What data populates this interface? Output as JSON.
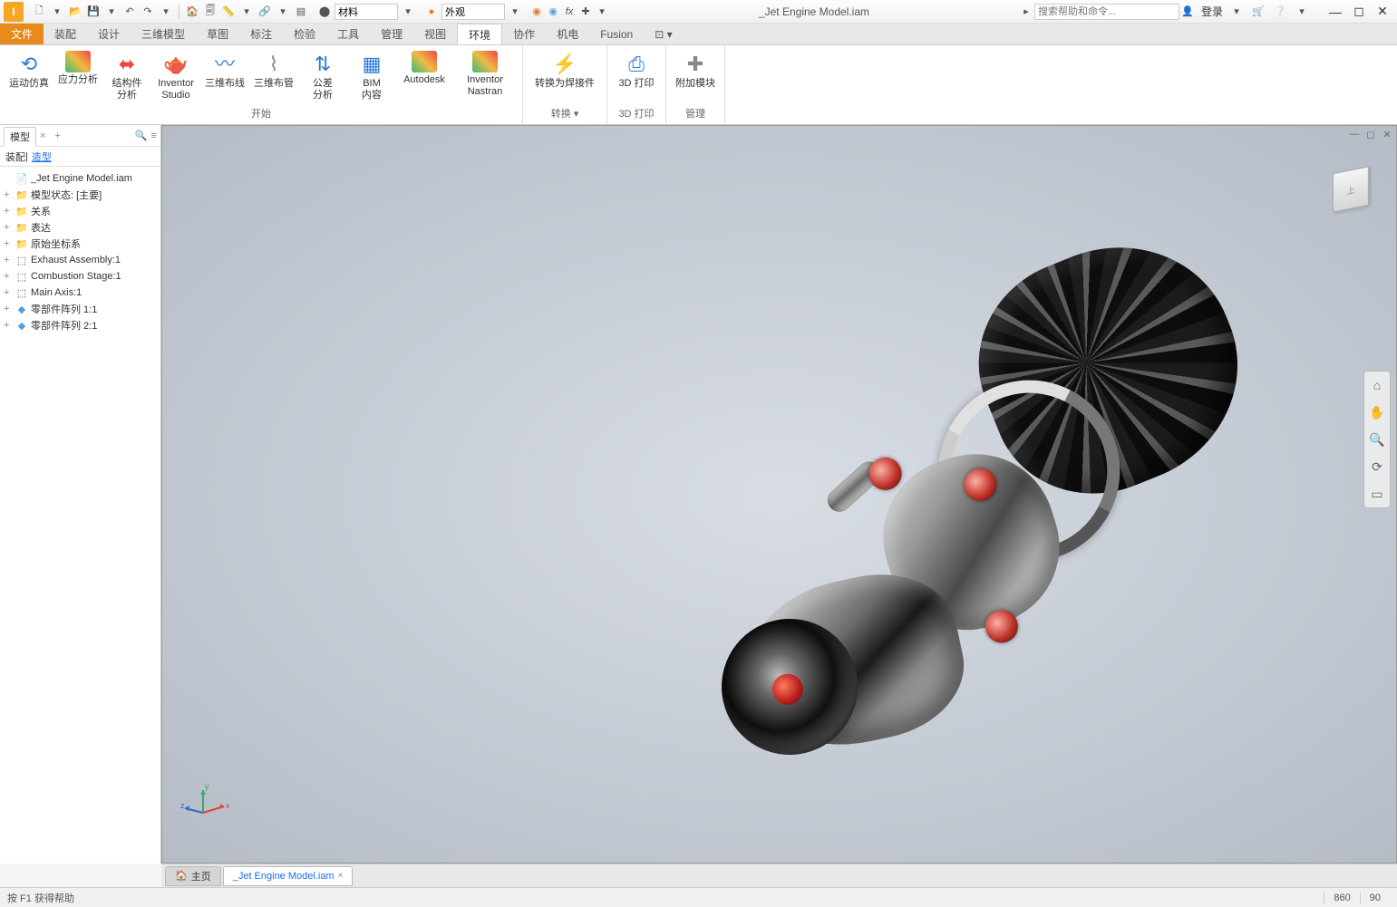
{
  "title": "_Jet Engine Model.iam",
  "search_placeholder": "搜索帮助和命令...",
  "login": "登录",
  "qat_material_label": "材料",
  "qat_appearance_label": "外观",
  "menu": {
    "file": "文件",
    "items": [
      "装配",
      "设计",
      "三维模型",
      "草图",
      "标注",
      "检验",
      "工具",
      "管理",
      "视图",
      "环境",
      "协作",
      "机电",
      "Fusion"
    ]
  },
  "ribbon": {
    "groups": [
      {
        "label": "开始",
        "items": [
          {
            "name": "motion-sim",
            "label": "运动仿真",
            "icon": "🌀"
          },
          {
            "name": "stress-analysis",
            "label": "应力分析",
            "icon": "📊"
          },
          {
            "name": "frame-analysis",
            "label": "结构件\n分析",
            "icon": "🔧"
          },
          {
            "name": "inventor-studio",
            "label": "Inventor\nStudio",
            "icon": "🎬"
          },
          {
            "name": "route-cable",
            "label": "三维布线",
            "icon": "〰️"
          },
          {
            "name": "route-tube",
            "label": "三维布管",
            "icon": "🔩"
          },
          {
            "name": "tolerance",
            "label": "公差\n分析",
            "icon": "📐"
          },
          {
            "name": "bim-content",
            "label": "BIM\n内容",
            "icon": "🏗️"
          },
          {
            "name": "autodesk",
            "label": "Autodesk",
            "icon": "🅰️"
          },
          {
            "name": "inventor-nastran",
            "label": "Inventor Nastran",
            "icon": "📈"
          }
        ]
      },
      {
        "label": "转换 ▾",
        "items": [
          {
            "name": "weldment",
            "label": "转换为焊接件",
            "icon": "⚡"
          }
        ]
      },
      {
        "label": "3D 打印",
        "items": [
          {
            "name": "3d-print",
            "label": "3D 打印",
            "icon": "🖨️"
          }
        ]
      },
      {
        "label": "管理",
        "items": [
          {
            "name": "addins",
            "label": "附加模块",
            "icon": "➕"
          }
        ]
      }
    ]
  },
  "panel": {
    "tab_model": "模型",
    "sub_assembly": "装配",
    "sub_modeling": "造型",
    "tree": [
      {
        "icon": "📄",
        "label": "_Jet Engine Model.iam",
        "indent": 0,
        "exp": ""
      },
      {
        "icon": "📁",
        "label": "模型状态: [主要]",
        "indent": 0,
        "exp": "+",
        "color": "#d9a441"
      },
      {
        "icon": "📁",
        "label": "关系",
        "indent": 0,
        "exp": "+",
        "color": "#d9a441"
      },
      {
        "icon": "📁",
        "label": "表达",
        "indent": 0,
        "exp": "+",
        "color": "#d9a441"
      },
      {
        "icon": "📁",
        "label": "原始坐标系",
        "indent": 0,
        "exp": "+",
        "color": "#d9a441"
      },
      {
        "icon": "⬚",
        "label": "Exhaust Assembly:1",
        "indent": 0,
        "exp": "+"
      },
      {
        "icon": "⬚",
        "label": "Combustion Stage:1",
        "indent": 0,
        "exp": "+"
      },
      {
        "icon": "⬚",
        "label": "Main Axis:1",
        "indent": 0,
        "exp": "+"
      },
      {
        "icon": "◆",
        "label": "零部件阵列 1:1",
        "indent": 0,
        "exp": "+",
        "color": "#4aa0e8"
      },
      {
        "icon": "◆",
        "label": "零部件阵列 2:1",
        "indent": 0,
        "exp": "+",
        "color": "#4aa0e8"
      }
    ]
  },
  "axis": {
    "x": "x",
    "y": "y",
    "z": "z"
  },
  "viewcube": {
    "face": "上"
  },
  "doc_tabs": {
    "home": "主页",
    "active": "_Jet Engine Model.iam"
  },
  "status": {
    "help": "按 F1 获得帮助",
    "num1": "860",
    "num2": "90"
  }
}
